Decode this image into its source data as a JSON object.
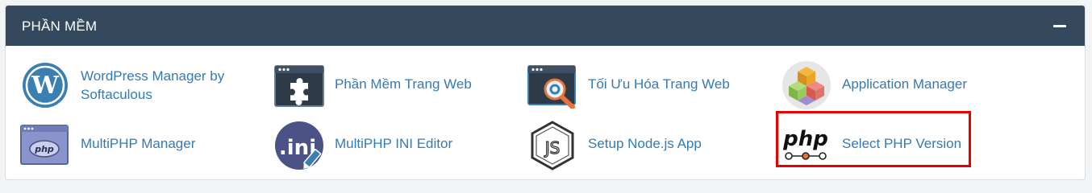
{
  "panel": {
    "title": "PHẦN MỀM",
    "collapse_icon": "minus-icon"
  },
  "apps": [
    {
      "label_line1": "WordPress Manager by",
      "label_line2": "Softaculous",
      "icon": "wordpress-icon"
    },
    {
      "label": "Phần Mềm Trang Web",
      "icon": "puzzle-icon"
    },
    {
      "label": "Tối Ưu Hóa Trang Web",
      "icon": "site-optimize-icon"
    },
    {
      "label": "Application Manager",
      "icon": "cubes-icon"
    },
    {
      "label": "MultiPHP Manager",
      "icon": "php-window-icon",
      "icon_text": "php"
    },
    {
      "label": "MultiPHP INI Editor",
      "icon": "ini-editor-icon",
      "icon_text": ".ini"
    },
    {
      "label": "Setup Node.js App",
      "icon": "nodejs-icon",
      "icon_text": "JS"
    },
    {
      "label": "Select PHP Version",
      "icon": "php-version-icon",
      "icon_text": "php",
      "highlighted": true
    }
  ],
  "colors": {
    "header_bg": "#34495e",
    "link": "#337ab7",
    "highlight": "#e60000"
  }
}
